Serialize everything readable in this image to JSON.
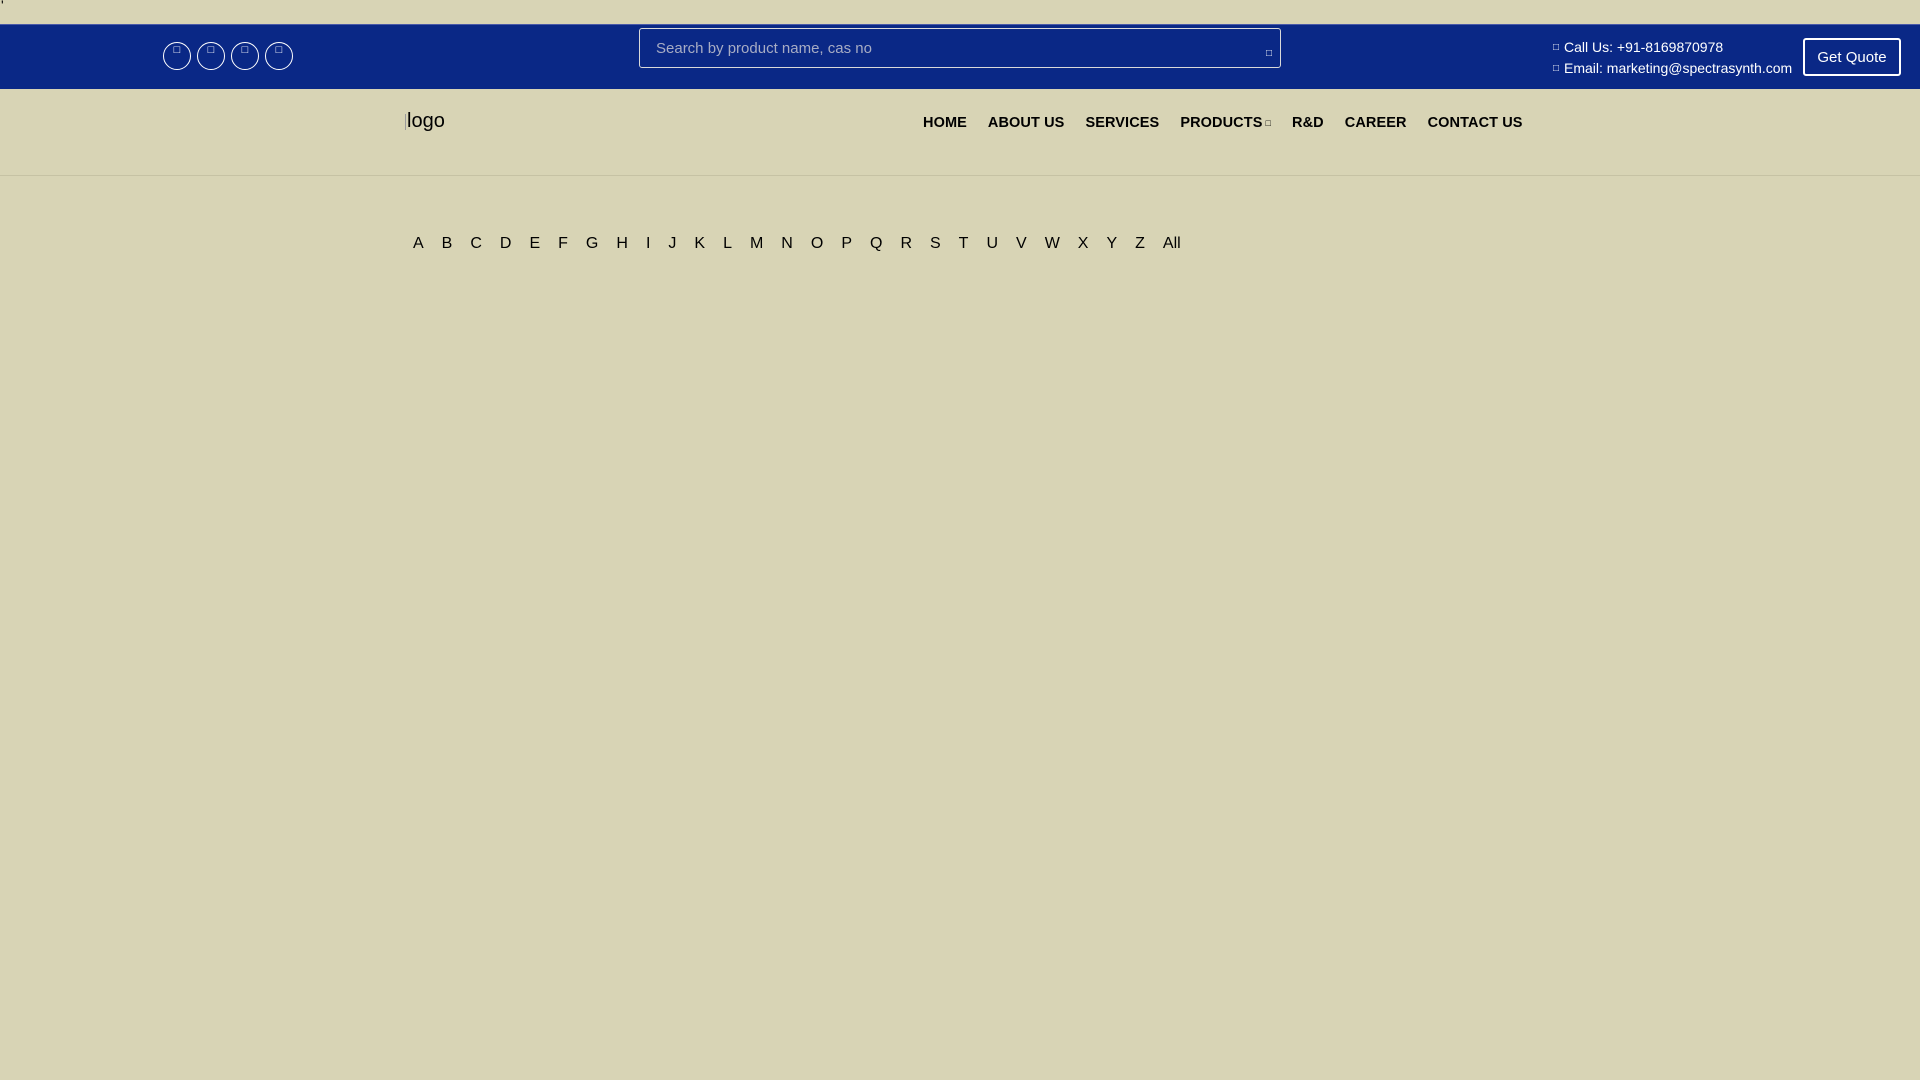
{
  "stray_mark": "'",
  "topbar": {
    "social_icons": [
      "facebook-icon",
      "twitter-icon",
      "linkedin-icon",
      "instagram-icon"
    ],
    "search": {
      "placeholder": "Search by product name, cas no",
      "value": ""
    },
    "contact": {
      "phone": "Call Us: +91-8169870978",
      "email": "Email: marketing@spectrasynth.com"
    },
    "cta_label": "Get Quote"
  },
  "header": {
    "logo_alt": "logo",
    "nav": [
      {
        "label": "HOME"
      },
      {
        "label": "ABOUT US"
      },
      {
        "label": "SERVICES"
      },
      {
        "label": "PRODUCTS"
      },
      {
        "label": "R&D"
      },
      {
        "label": "CAREER"
      },
      {
        "label": "CONTACT US"
      }
    ]
  },
  "alphabet_filter": [
    "A",
    "B",
    "C",
    "D",
    "E",
    "F",
    "G",
    "H",
    "I",
    "J",
    "K",
    "L",
    "M",
    "N",
    "O",
    "P",
    "Q",
    "R",
    "S",
    "T",
    "U",
    "V",
    "W",
    "X",
    "Y",
    "Z",
    "All"
  ],
  "colors": {
    "page_bg": "#d8d4b5",
    "topbar_bg": "#0a2886",
    "text_light": "#ffffff",
    "text_dark": "#000000"
  }
}
